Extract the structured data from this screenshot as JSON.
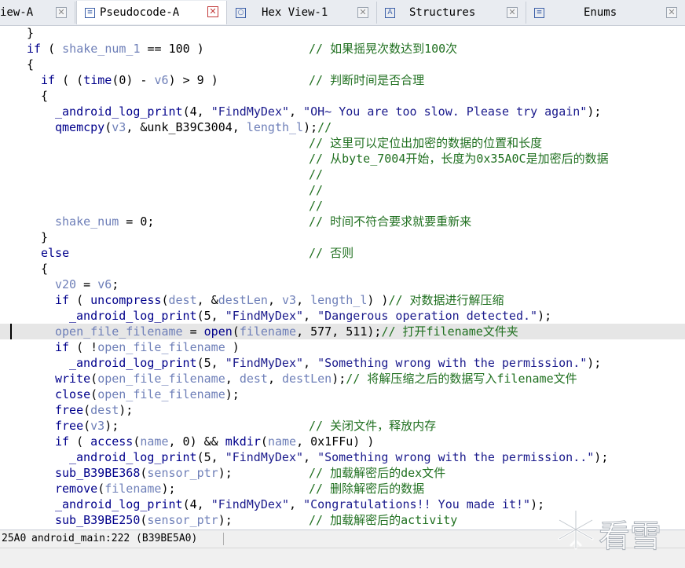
{
  "tabs": [
    {
      "label": "iew-A",
      "close": "✕"
    },
    {
      "label": "Pseudocode-A",
      "close": "✕"
    },
    {
      "label": "Hex View-1",
      "close": "✕"
    },
    {
      "label": "Structures",
      "close": "✕"
    },
    {
      "label": "Enums",
      "close": "✕"
    }
  ],
  "code": {
    "l1": "}",
    "l2": {
      "kw": "if",
      "cond_open": " ( ",
      "var": "shake_num_1",
      "rest": " == 100 )",
      "comment": "// 如果摇晃次数达到100次"
    },
    "l3": "{",
    "l4": {
      "kw": "if",
      "a": " ( (",
      "fn": "time",
      "b": "(0) - ",
      "var": "v6",
      "c": ") > 9 )",
      "comment": "// 判断时间是否合理"
    },
    "l5": "{",
    "l6": {
      "fn": "_android_log_print",
      "a": "(4, ",
      "s1": "\"FindMyDex\"",
      "b": ", ",
      "s2": "\"OH~ You are too slow. Please try again\"",
      "c": ");"
    },
    "l7": {
      "fn": "qmemcpy",
      "a": "(",
      "var": "v3",
      "b": ", &unk_B39C3004, ",
      "var2": "length_l",
      "c": ");",
      "comment": "//"
    },
    "l8": "// 这里可以定位出加密的数据的位置和长度",
    "l9": "// 从byte_7004开始，长度为0x35A0C是加密后的数据",
    "l10": "//",
    "l11": "//",
    "l12": "//",
    "l13": {
      "var": "shake_num",
      "rest": " = 0;",
      "comment": "// 时间不符合要求就要重新来"
    },
    "l14": "}",
    "l15": {
      "kw": "else",
      "comment": "// 否则"
    },
    "l16": "{",
    "l17": {
      "var": "v20",
      "rest": " = ",
      "var2": "v6",
      "end": ";"
    },
    "l18": {
      "kw": "if",
      "a": " ( ",
      "fn": "uncompress",
      "b": "(",
      "v1": "dest",
      "c": ", &",
      "v2": "destLen",
      "d": ", ",
      "v3": "v3",
      "e": ", ",
      "v4": "length_l",
      "f": ") )",
      "comment": "// 对数据进行解压缩"
    },
    "l19": {
      "fn": "_android_log_print",
      "a": "(5, ",
      "s1": "\"FindMyDex\"",
      "b": ", ",
      "s2": "\"Dangerous operation detected.\"",
      "c": ");"
    },
    "l20": {
      "var": "open_file_filename",
      "a": " = ",
      "fn": "open",
      "b": "(",
      "v2": "filename",
      "c": ", 577, 511);",
      "comment": "// 打开filename文件夹"
    },
    "l21": {
      "kw": "if",
      "a": " ( !",
      "var": "open_file_filename",
      "b": " )"
    },
    "l22": {
      "fn": "_android_log_print",
      "a": "(5, ",
      "s1": "\"FindMyDex\"",
      "b": ", ",
      "s2": "\"Something wrong with the permission.\"",
      "c": ");"
    },
    "l23": {
      "fn": "write",
      "a": "(",
      "v1": "open_file_filename",
      "b": ", ",
      "v2": "dest",
      "c": ", ",
      "v3": "destLen",
      "d": ");",
      "comment": "// 将解压缩之后的数据写入filename文件"
    },
    "l24": {
      "fn": "close",
      "a": "(",
      "var": "open_file_filename",
      "b": ");"
    },
    "l25": {
      "fn": "free",
      "a": "(",
      "var": "dest",
      "b": ");"
    },
    "l26": {
      "fn": "free",
      "a": "(",
      "var": "v3",
      "b": ");",
      "comment": "// 关闭文件，释放内存"
    },
    "l27": {
      "kw": "if",
      "a": " ( ",
      "fn": "access",
      "b": "(",
      "v1": "name",
      "c": ", 0) && ",
      "fn2": "mkdir",
      "d": "(",
      "v2": "name",
      "e": ", 0x1FFu) )"
    },
    "l28": {
      "fn": "_android_log_print",
      "a": "(5, ",
      "s1": "\"FindMyDex\"",
      "b": ", ",
      "s2": "\"Something wrong with the permission..\"",
      "c": ");"
    },
    "l29": {
      "fn": "sub_B39BE368",
      "a": "(",
      "var": "sensor_ptr",
      "b": ");",
      "comment": "// 加载解密后的dex文件"
    },
    "l30": {
      "fn": "remove",
      "a": "(",
      "var": "filename",
      "b": ");",
      "comment": "// 删除解密后的数据"
    },
    "l31": {
      "fn": "_android_log_print",
      "a": "(4, ",
      "s1": "\"FindMyDex\"",
      "b": ", ",
      "s2": "\"Congratulations!! You made it!\"",
      "c": ");"
    },
    "l32": {
      "fn": "sub_B39BE250",
      "a": "(",
      "var": "sensor_ptr",
      "b": ");",
      "comment": "// 加载解密后的activity"
    }
  },
  "status": {
    "addr": "25A0",
    "func": "android_main:222 (B39BE5A0)"
  },
  "watermark": {
    "text": "看雪"
  },
  "colors": {
    "keyword": "#00008b",
    "variable": "#6e7fb8",
    "comment": "#207020",
    "highlight": "#e6e6e6"
  }
}
